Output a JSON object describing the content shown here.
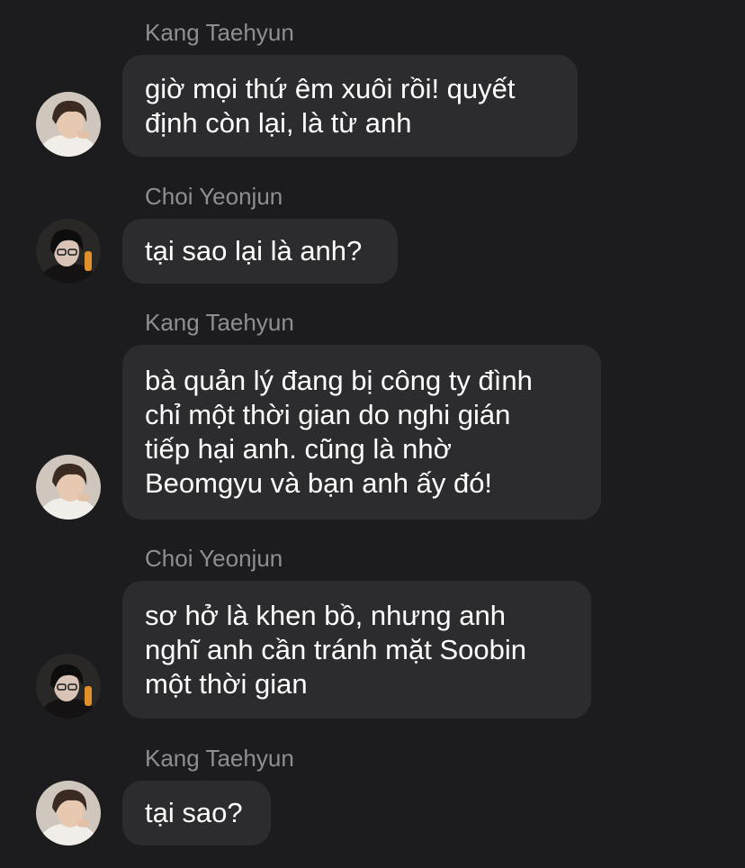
{
  "conversation": {
    "messages": [
      {
        "sender": "Kang Taehyun",
        "avatar_icon": "kang-taehyun-avatar",
        "text": "giờ mọi thứ êm xuôi rồi! quyết\nđịnh còn lại, là từ anh"
      },
      {
        "sender": "Choi Yeonjun",
        "avatar_icon": "choi-yeonjun-avatar",
        "text": "tại sao lại là anh?"
      },
      {
        "sender": "Kang Taehyun",
        "avatar_icon": "kang-taehyun-avatar",
        "text": "bà quản lý đang bị công ty đình\nchỉ một thời gian do nghi gián\ntiếp hại anh. cũng là nhờ\nBeomgyu và bạn anh ấy đó!"
      },
      {
        "sender": "Choi Yeonjun",
        "avatar_icon": "choi-yeonjun-avatar",
        "text": "sơ hở là khen bồ, nhưng anh\nnghĩ anh cần tránh mặt Soobin\nmột thời gian"
      },
      {
        "sender": "Kang Taehyun",
        "avatar_icon": "kang-taehyun-avatar",
        "text": "tại sao?"
      }
    ]
  },
  "colors": {
    "background": "#1c1c1e",
    "bubble": "#2c2c2e",
    "sender_name": "#8e8e93",
    "message_text": "#ffffff"
  }
}
